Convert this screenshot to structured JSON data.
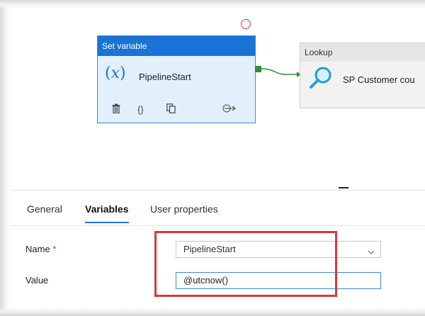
{
  "canvas": {
    "set_variable": {
      "header": "Set variable",
      "name": "PipelineStart",
      "variable_icon": "variable-x-icon",
      "tools": [
        "delete-icon",
        "code-braces-icon",
        "copy-icon",
        "arrow-connect-icon"
      ],
      "braces_glyph": "{}"
    },
    "lookup": {
      "header": "Lookup",
      "name": "SP Customer cou",
      "icon": "magnifier-icon"
    },
    "colors": {
      "activity_header": "#1a73d6",
      "activity_body": "#e1f0fb",
      "success_port": "#2f8f3a",
      "failure_circle": "#e0333c"
    }
  },
  "panel": {
    "tabs": [
      {
        "label": "General",
        "active": false
      },
      {
        "label": "Variables",
        "active": true
      },
      {
        "label": "User properties",
        "active": false
      }
    ],
    "fields": {
      "name_label": "Name",
      "required_mark": "*",
      "name_value": "PipelineStart",
      "value_label": "Value",
      "value_value": "@utcnow()"
    },
    "highlight_color": "#d9363e"
  }
}
